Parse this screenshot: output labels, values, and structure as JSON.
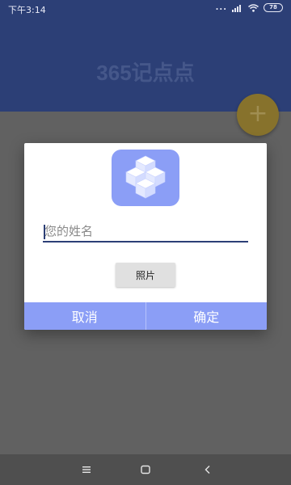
{
  "status_bar": {
    "time": "下午3:14",
    "dots": "...",
    "battery": "78"
  },
  "header": {
    "title": "365记点点"
  },
  "fab": {
    "label": "+"
  },
  "dialog": {
    "name_input": {
      "placeholder": "您的姓名",
      "value": ""
    },
    "photo_button": "照片",
    "cancel_button": "取消",
    "confirm_button": "确定"
  },
  "colors": {
    "primary": "#2c3f76",
    "dialog_accent": "#8b9ef6",
    "fab": "#87722c",
    "scrim_background": "#616161"
  },
  "icons": [
    "signal-icon",
    "wifi-icon",
    "battery-icon",
    "app-logo-icon",
    "menu-icon",
    "home-icon",
    "back-icon"
  ]
}
